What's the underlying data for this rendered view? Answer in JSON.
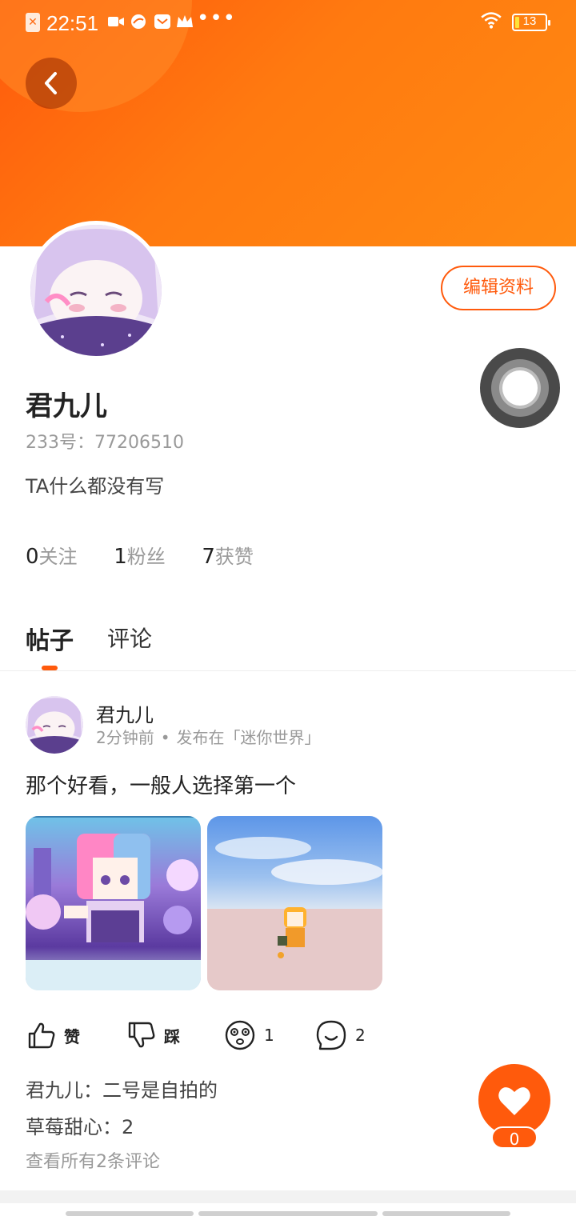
{
  "statusbar": {
    "time": "22:51",
    "battery": "13",
    "more": "•••"
  },
  "colors": {
    "accent": "#ff5a0c",
    "banner_gradient_start": "#ff5a0c",
    "banner_gradient_end": "#ff8a12"
  },
  "profile": {
    "name": "君九儿",
    "id_text": "233号：77206510",
    "bio": "TA什么都没有写",
    "edit_label": "编辑资料",
    "stats": [
      {
        "num": "0",
        "label": "关注"
      },
      {
        "num": "1",
        "label": "粉丝"
      },
      {
        "num": "7",
        "label": "获赞"
      }
    ]
  },
  "tabs": [
    {
      "label": "帖子",
      "active": true
    },
    {
      "label": "评论",
      "active": false
    }
  ],
  "post": {
    "author": "君九儿",
    "time": "2分钟前",
    "dot": "•",
    "location": "发布在「迷你世界」",
    "text": "那个好看，一般人选择第一个",
    "actions": {
      "like": "赞",
      "dislike": "踩",
      "reaction_count": "1",
      "comment_count": "2"
    },
    "comments": [
      {
        "user": "君九儿",
        "text": "二号是自拍的"
      },
      {
        "user": "草莓甜心",
        "text": "2"
      }
    ],
    "view_all": "查看所有2条评论",
    "like_count": "0"
  },
  "icons": [
    "back-icon",
    "thumb-up-icon",
    "thumb-down-icon",
    "dizzy-face-icon",
    "comment-icon",
    "heart-icon",
    "wifi-icon",
    "battery-icon"
  ]
}
